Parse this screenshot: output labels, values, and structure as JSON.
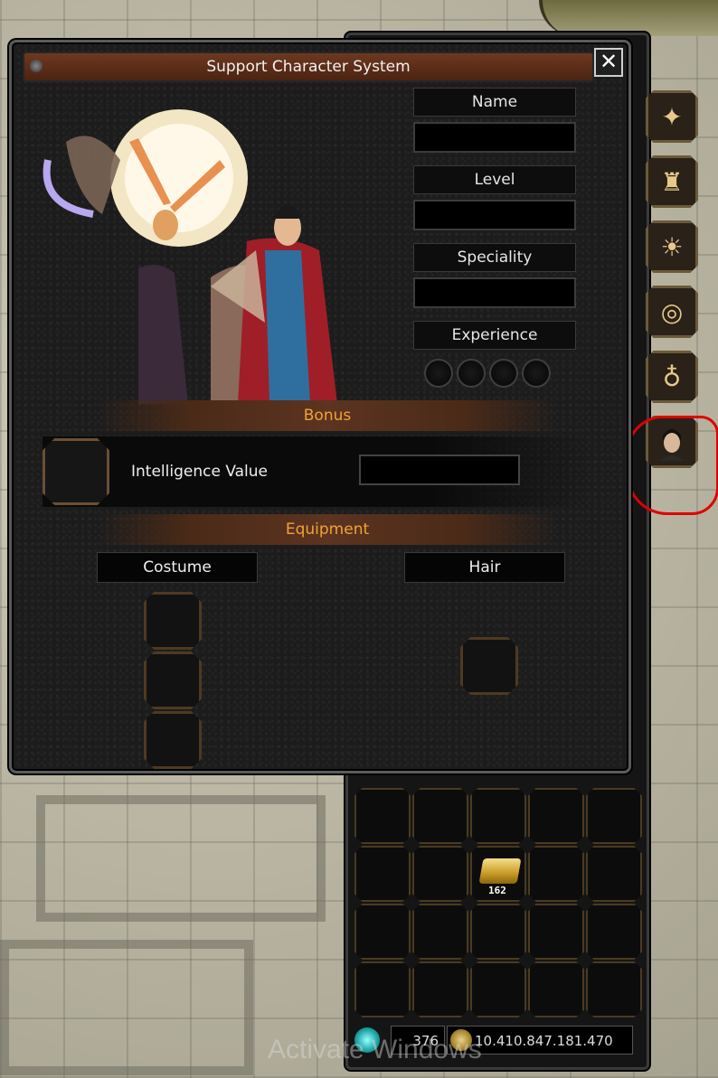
{
  "window": {
    "title": "Support Character System",
    "close_icon": "close-icon"
  },
  "info": {
    "name_label": "Name",
    "name_value": "",
    "level_label": "Level",
    "level_value": "",
    "speciality_label": "Speciality",
    "speciality_value": "",
    "experience_label": "Experience"
  },
  "bonus": {
    "section_title": "Bonus",
    "intelligence_label": "Intelligence Value",
    "intelligence_value": ""
  },
  "equipment": {
    "section_title": "Equipment",
    "costume_label": "Costume",
    "hair_label": "Hair"
  },
  "side_tabs": [
    {
      "icon": "wings-icon"
    },
    {
      "icon": "altar-icon"
    },
    {
      "icon": "sun-icon"
    },
    {
      "icon": "ring-icon"
    },
    {
      "icon": "bag-icon"
    },
    {
      "icon": "support-character-icon"
    }
  ],
  "inventory": {
    "gold_item_count": "162"
  },
  "currency": {
    "gem_amount": "376",
    "gold_amount": "10.410.847.181.470"
  },
  "watermark": "Activate Windows",
  "colors": {
    "section_text": "#f0a335",
    "title_bar": "#5a2c17",
    "highlight": "#e00000"
  }
}
